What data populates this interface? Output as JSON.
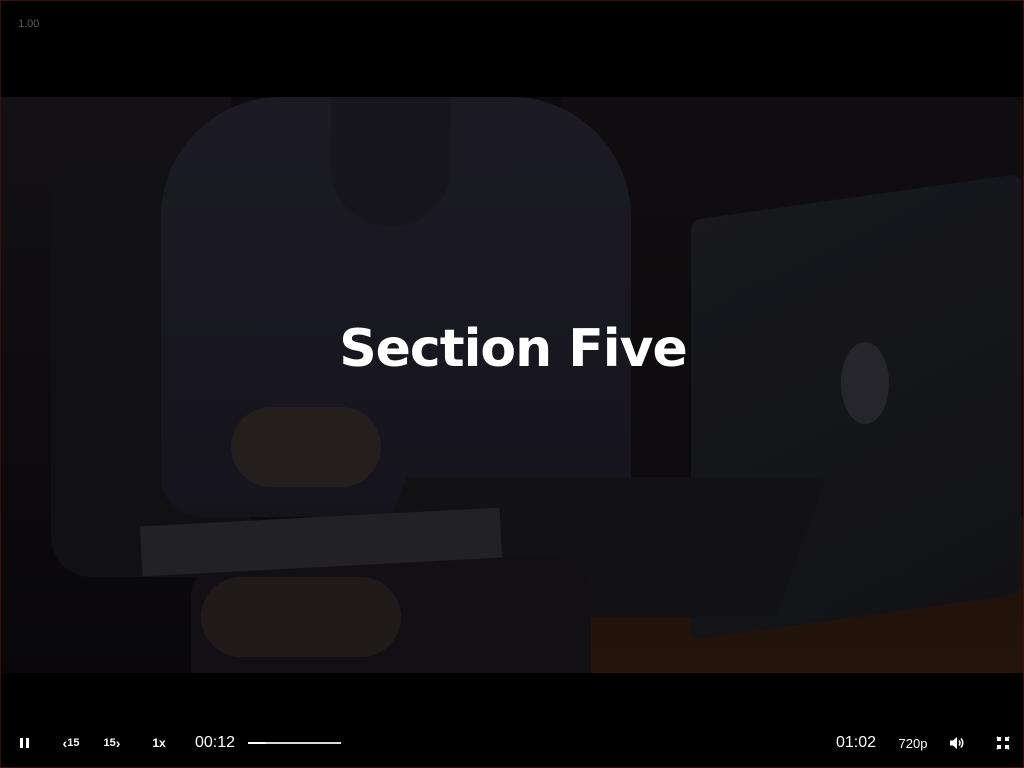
{
  "player": {
    "zoom_level": "1.00",
    "section_title": "Section Five"
  },
  "controls": {
    "pause_icon": "pause-icon",
    "rewind_label": "15",
    "rewind_icon": "chevron-left-icon",
    "forward_label": "15",
    "forward_icon": "chevron-right-icon",
    "speed_label": "1x",
    "current_time": "00:12",
    "total_time": "01:02",
    "progress_fraction": 0.19,
    "quality_label": "720p",
    "volume_icon": "volume-icon",
    "fullscreen_icon": "exit-fullscreen-icon"
  },
  "colors": {
    "background": "#000000",
    "text": "#ffffff",
    "zoom_text": "#5a5a5a"
  }
}
